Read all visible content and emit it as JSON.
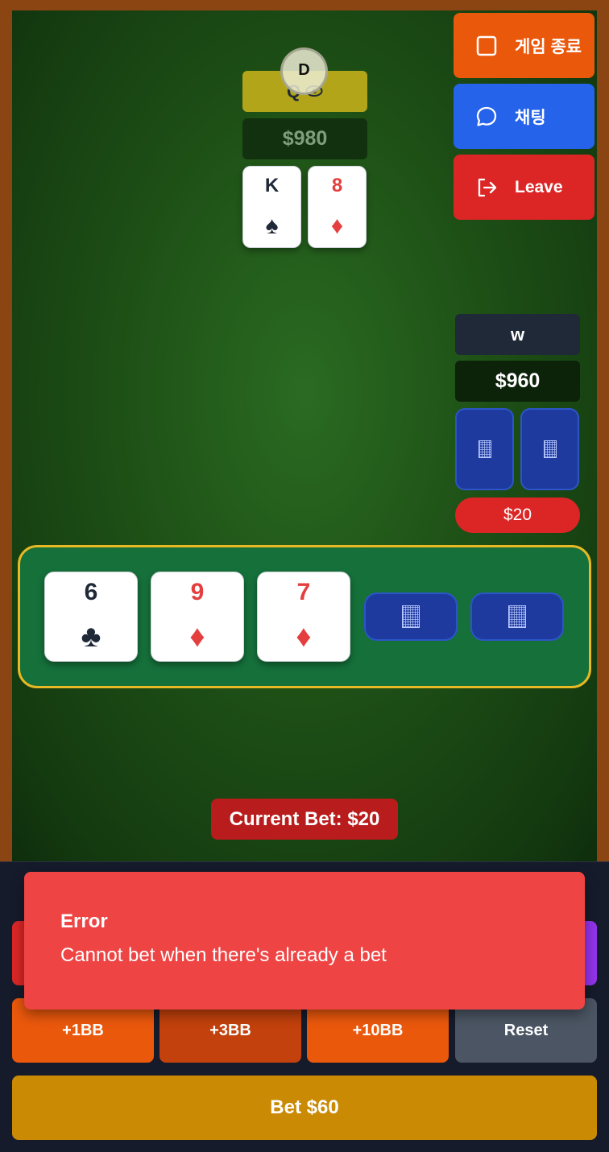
{
  "top_player": {
    "name": "Q",
    "dealer_label": "D",
    "stack": "$980",
    "cards": [
      {
        "rank": "K",
        "suit": "♠",
        "color": "black"
      },
      {
        "rank": "8",
        "suit": "♦",
        "color": "red"
      }
    ]
  },
  "right_player": {
    "name": "w",
    "stack": "$960",
    "bet": "$20"
  },
  "side_buttons": {
    "end_game": "게임 종료",
    "chat": "채팅",
    "leave": "Leave"
  },
  "board": {
    "cards": [
      {
        "rank": "6",
        "suit": "♣",
        "color": "black"
      },
      {
        "rank": "9",
        "suit": "♦",
        "color": "red"
      },
      {
        "rank": "7",
        "suit": "♦",
        "color": "red"
      }
    ],
    "face_down_count": 2
  },
  "current_bet": "Current Bet: $20",
  "controls": {
    "plus_1bb": "+1BB",
    "plus_3bb": "+3BB",
    "plus_10bb": "+10BB",
    "reset": "Reset",
    "bet": "Bet $60"
  },
  "toast": {
    "title": "Error",
    "message": "Cannot bet when there's already a bet"
  },
  "colors": {
    "frame": "#8b4513",
    "felt": "#1e5016",
    "board_border": "#e8b923",
    "end_game_button": "#ea580c",
    "chat_button": "#2563eb",
    "leave_button": "#dc2626",
    "bet_button": "#ca8a04",
    "error_toast": "#ef4444"
  },
  "icons": {
    "end_game": "stop-square-icon",
    "chat": "chat-bubble-icon",
    "leave": "logout-icon",
    "name_badge": "eye-icon",
    "card_back": "card-back-pattern-icon"
  }
}
